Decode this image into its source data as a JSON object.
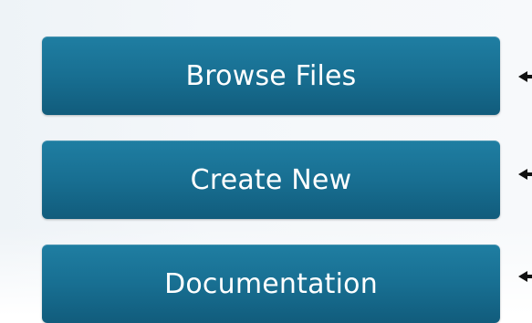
{
  "menu": {
    "buttons": [
      {
        "label": "Browse Files"
      },
      {
        "label": "Create New"
      },
      {
        "label": "Documentation"
      }
    ]
  },
  "colors": {
    "button_top": "#1f7ea2",
    "button_bottom": "#115c7c",
    "button_text": "#ffffff",
    "panel_background": "#f4f7fa",
    "pointer": "#111111"
  },
  "icons": [
    "arrow-left-icon"
  ]
}
